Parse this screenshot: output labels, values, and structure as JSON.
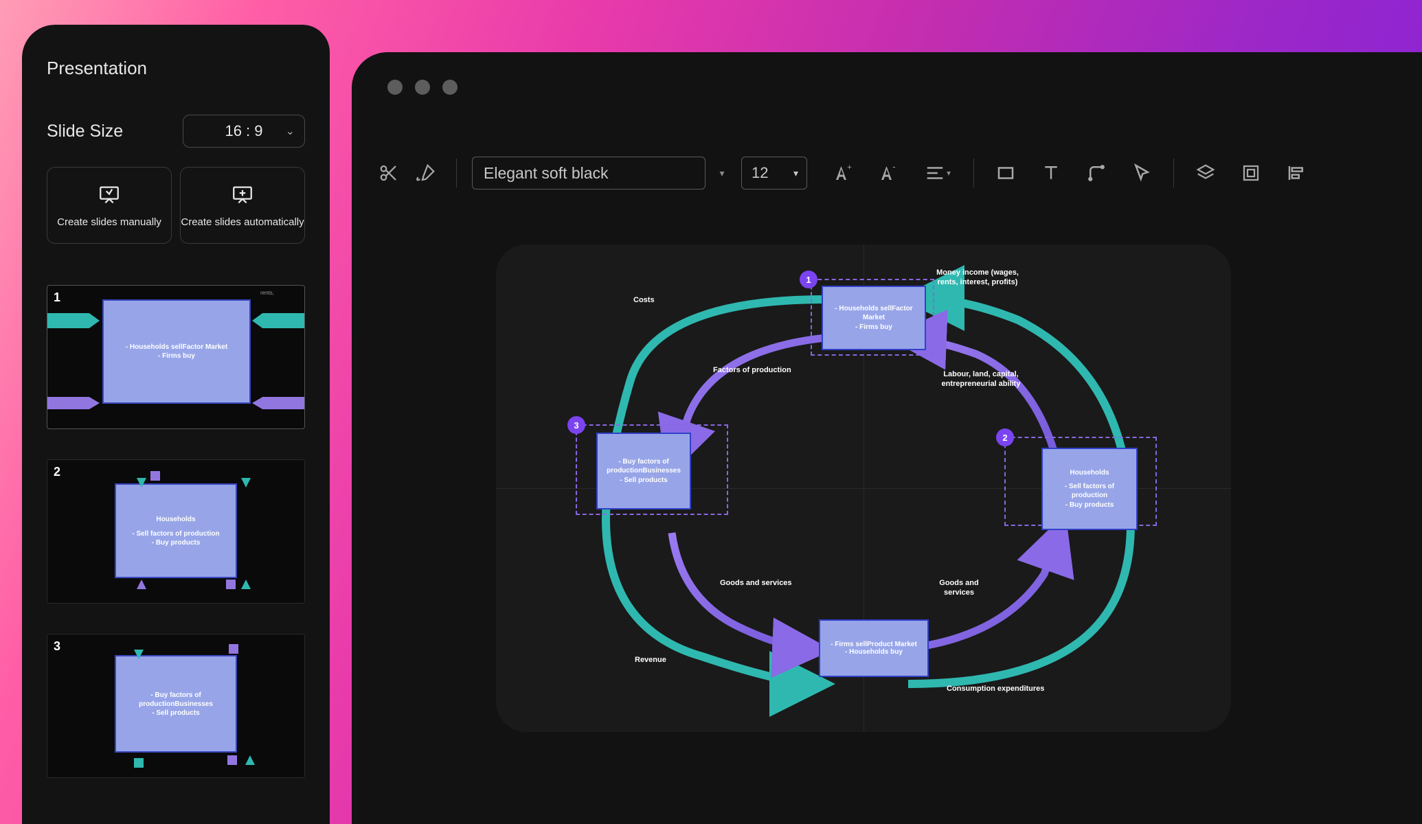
{
  "sidebar": {
    "title": "Presentation",
    "size_label": "Slide Size",
    "size_value": "16 : 9",
    "create_manual": "Create slides manually",
    "create_auto": "Create slides automatically",
    "thumbs": [
      {
        "num": "1",
        "line1": "- Households sellFactor Market",
        "line2": "- Firms buy"
      },
      {
        "num": "2",
        "line1": "Households",
        "line2": "- Sell factors of production",
        "line3": "- Buy products"
      },
      {
        "num": "3",
        "line1": "- Buy factors of",
        "line2": "productionBusinesses",
        "line3": "- Sell products"
      }
    ]
  },
  "toolbar": {
    "style_name": "Elegant soft black",
    "font_size": "12"
  },
  "diagram": {
    "nodes": {
      "top": {
        "badge": "1",
        "l1": "- Households sellFactor Market",
        "l2": "- Firms buy"
      },
      "right": {
        "badge": "2",
        "l1": "Households",
        "l2": "- Sell factors of production",
        "l3": "- Buy products"
      },
      "left": {
        "badge": "3",
        "l1": "- Buy factors of",
        "l2": "productionBusinesses",
        "l3": "- Sell products"
      },
      "bottom": {
        "l1": "- Firms sellProduct Market",
        "l2": "- Households buy"
      }
    },
    "labels": {
      "money_income": "Money income (wages, rents, interest, profits)",
      "costs": "Costs",
      "factors": "Factors of production",
      "labour": "Labour, land, capital, entrepreneurial ability",
      "goods_left": "Goods and services",
      "goods_right": "Goods and services",
      "revenue": "Revenue",
      "consumption": "Consumption expenditures"
    }
  },
  "colors": {
    "teal": "#2fb8b0",
    "purple": "#8a6ae6",
    "node": "#97a5e8"
  }
}
